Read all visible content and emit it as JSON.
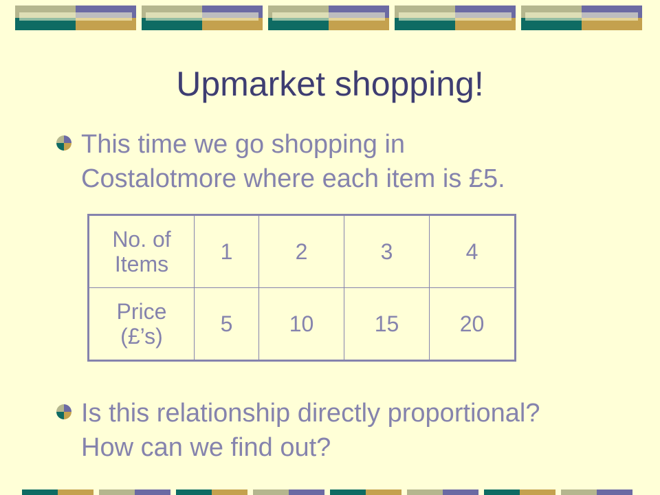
{
  "slide": {
    "title": "Upmarket shopping!",
    "bullets": [
      {
        "lines": [
          "This time we go shopping in",
          "Costalotmore where each item is £5."
        ]
      },
      {
        "lines": [
          "Is this relationship directly proportional?",
          "How can we find out?"
        ]
      }
    ],
    "table": {
      "rows": [
        {
          "header_lines": [
            "No. of",
            "Items"
          ],
          "values": [
            "1",
            "2",
            "3",
            "4"
          ]
        },
        {
          "header_lines": [
            "Price",
            "(£’s)"
          ],
          "values": [
            "5",
            "10",
            "15",
            "20"
          ]
        }
      ]
    }
  },
  "colors": {
    "background": "#ffffd7",
    "title": "#3e3d72",
    "text": "#8583ad",
    "deco_olive": "#b5b68e",
    "deco_purple": "#6b6aa3",
    "deco_teal": "#0e6b63",
    "deco_gold": "#c4a14e"
  }
}
